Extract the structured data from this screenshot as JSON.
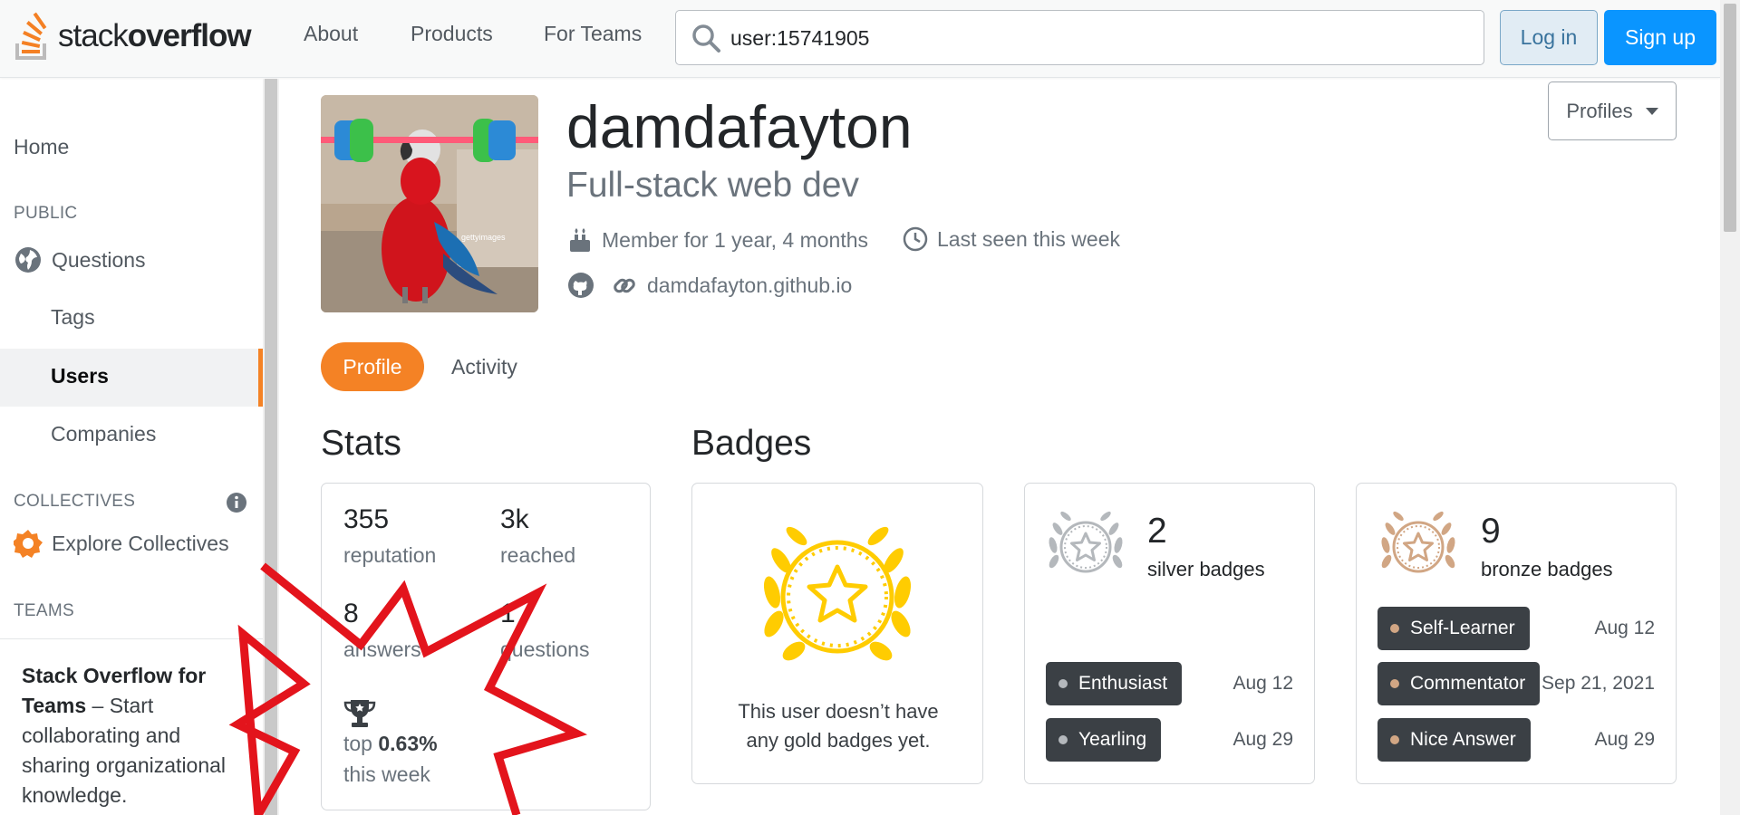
{
  "header": {
    "logo_light": "stack",
    "logo_bold": "overflow",
    "nav": [
      "About",
      "Products",
      "For Teams"
    ],
    "search_value": "user:15741905",
    "login_label": "Log in",
    "signup_label": "Sign up"
  },
  "sidebar": {
    "home": "Home",
    "public_heading": "PUBLIC",
    "questions": "Questions",
    "tags": "Tags",
    "users": "Users",
    "companies": "Companies",
    "collectives_heading": "COLLECTIVES",
    "explore_collectives": "Explore Collectives",
    "teams_heading": "TEAMS",
    "teams_title": "Stack Overflow for Teams",
    "teams_text": " – Start collaborating and sharing organizational knowledge."
  },
  "profile": {
    "name": "damdafayton",
    "title": "Full-stack web dev",
    "member_for": "Member for 1 year, 4 months",
    "last_seen": "Last seen this week",
    "website": "damdafayton.github.io",
    "avatar_watermark": "gettyimages",
    "profiles_button": "Profiles"
  },
  "tabs": {
    "profile": "Profile",
    "activity": "Activity"
  },
  "stats": {
    "heading": "Stats",
    "reputation_value": "355",
    "reputation_label": "reputation",
    "reached_value": "3k",
    "reached_label": "reached",
    "answers_value": "8",
    "answers_label": "answers",
    "questions_value": "1",
    "questions_label": "questions",
    "top_prefix": "top ",
    "top_value": "0.63%",
    "top_suffix": "this week"
  },
  "badges": {
    "heading": "Badges",
    "gold_text": "This user doesn’t have any gold badges yet.",
    "silver_count": "2",
    "silver_label": "silver badges",
    "silver_items": [
      {
        "name": "Enthusiast",
        "date": "Aug 12"
      },
      {
        "name": "Yearling",
        "date": "Aug 29"
      }
    ],
    "bronze_count": "9",
    "bronze_label": "bronze badges",
    "bronze_items": [
      {
        "name": "Self-Learner",
        "date": "Aug 12"
      },
      {
        "name": "Commentator",
        "date": "Sep 21, 2021"
      },
      {
        "name": "Nice Answer",
        "date": "Aug 29"
      }
    ]
  },
  "colors": {
    "accent": "#f48225",
    "gold": "#ffcc01",
    "silver": "#b4b8bc",
    "bronze": "#d1a684",
    "annotation_red": "#e3141c"
  }
}
